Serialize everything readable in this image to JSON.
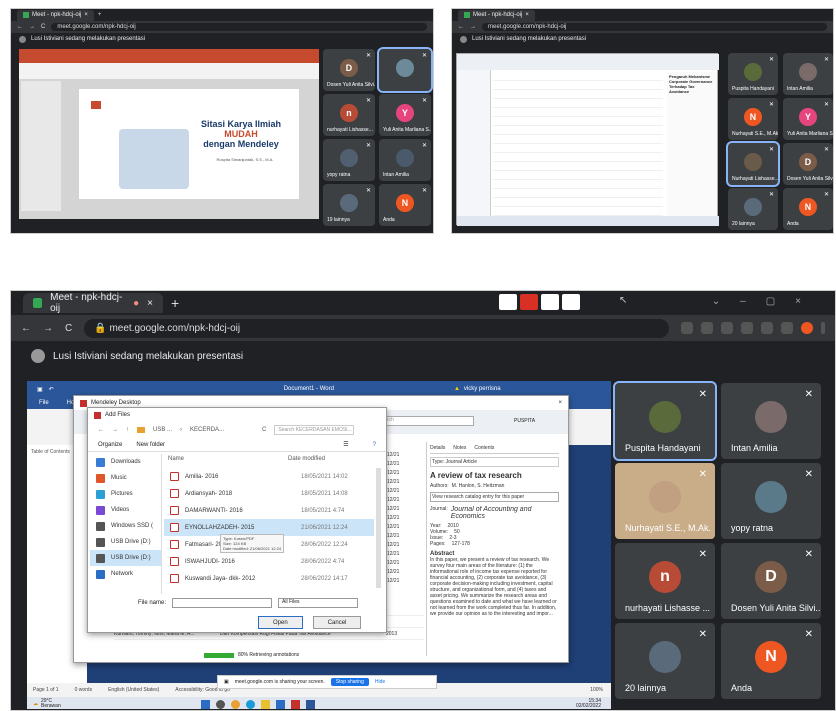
{
  "shot1": {
    "tab": "Meet - npk-hdcj-oij",
    "url": "meet.google.com/npk-hdcj-oij",
    "presenting": "Lusi Istiviani sedang melakukan presentasi",
    "slide": {
      "title1": "Sitasi Karya Ilmiah",
      "title2": "MUDAH",
      "title3": "dengan Mendeley",
      "author": "Rospita Simanjuntak, S.S., M.A."
    },
    "tiles": [
      {
        "initial": "D",
        "color": "#7b5c48",
        "name": "Dosen Yuli Anita Silvi..."
      },
      {
        "initial": "",
        "color": "#6d8a9a",
        "name": ""
      },
      {
        "initial": "n",
        "color": "#b84b36",
        "name": "nurhayati Lishasse..."
      },
      {
        "initial": "Y",
        "color": "#e6447c",
        "name": "Yuli Anita Marliana S..."
      },
      {
        "initial": "",
        "color": "#506070",
        "name": "yopy ratna"
      },
      {
        "initial": "",
        "color": "#4a5a6a",
        "name": "Intan Amilia"
      },
      {
        "initial": "",
        "color": "#5a6a7a",
        "name": "19 lainnya"
      },
      {
        "initial": "N",
        "color": "#ee5722",
        "name": "Anda"
      }
    ]
  },
  "shot2": {
    "tab": "Meet - npk-hdcj-oij",
    "url": "meet.google.com/npk-hdcj-oij",
    "presenting": "Lusi Istiviani sedang melakukan presentasi",
    "doc_title": "Pengaruh Mekanisme Corporate Governance Terhadap Tax Avoidance",
    "tiles": [
      {
        "initial": "",
        "color": "#5a6a3a",
        "name": "Puspita Handayani"
      },
      {
        "initial": "",
        "color": "#7a6a6a",
        "name": "Intan Amilia"
      },
      {
        "initial": "N",
        "color": "#ee5722",
        "name": "Nurhayati S.E., M.Ak."
      },
      {
        "initial": "Y",
        "color": "#e6447c",
        "name": "Yuli Anita Marliana S..."
      },
      {
        "initial": "",
        "color": "#6a5a4a",
        "name": "Nurhayati Lishasse..."
      },
      {
        "initial": "D",
        "color": "#7b5c48",
        "name": "Dosen Yuli Anita Silvi..."
      },
      {
        "initial": "",
        "color": "#5a6a7a",
        "name": "20 lainnya"
      },
      {
        "initial": "N",
        "color": "#ee5722",
        "name": "Anda"
      }
    ]
  },
  "shot3": {
    "tab": "Meet - npk-hdcj-oij",
    "url": "meet.google.com/npk-hdcj-oij",
    "presenting": "Lusi Istiviani sedang melakukan presentasi",
    "word": {
      "title": "Document1 - Word",
      "user": "vicky perrisna",
      "menu": [
        "File",
        "Home"
      ],
      "toc": "Table of Contents"
    },
    "mendeley": {
      "title": "Mendeley Desktop",
      "search_placeholder": "Search",
      "user": "PUSPITA",
      "dates": [
        "28/12/21",
        "28/12/21",
        "28/12/21",
        "28/12/21",
        "28/12/21",
        "28/12/21",
        "28/12/21",
        "28/12/21",
        "28/12/21",
        "28/12/21",
        "28/12/21",
        "28/12/21",
        "28/12/21",
        "28/12/21",
        "28/12/21"
      ],
      "tabs": [
        "Details",
        "Notes",
        "Contents"
      ],
      "type_label": "Type: Journal Article",
      "doc_title": "A review of tax research",
      "authors_label": "Authors:",
      "authors": "M. Hanlon, S. Heitzman",
      "view_catalog": "View research catalog entry for this paper",
      "journal_label": "Journal:",
      "journal": "Journal of Accounting and Economics",
      "year_label": "Year:",
      "year": "2010",
      "volume_label": "Volume:",
      "volume": "50",
      "issue_label": "Issue:",
      "issue": "2-3",
      "pages_label": "Pages:",
      "pages": "127-178",
      "abstract_label": "Abstract",
      "abstract": "In this paper, we present a review of tax research. We survey four main areas of the literature: (1) the informational role of income tax expense reported for financial accounting, (2) corporate tax avoidance, (3) corporate decision-making including investment, capital structure, and organizational form, and (4) taxes and asset pricing. We summarize the research areas and questions examined to date and what we have learned or not learned from the work completed thus far. In addition, we provide our opinion as to the interesting and impor...",
      "bottom_rows": [
        {
          "a": "Adhitara, Amali; Adjez, Charles K.",
          "b": "",
          "c": ""
        },
        {
          "a": "Dianty, Yunita Eka; M...",
          "b": "Pengaruh Pajak, Kepemilikan dan Kondisi Keuangan...",
          "c": ""
        },
        {
          "a": "Kurniarti, Tommy; Idris, Maria M; A...",
          "b": "Dan Kompensasi Rugi Fiskal Pada Tax Avoidance",
          "c": "2013"
        }
      ],
      "status": "80%  Retrieving annotations"
    },
    "dialog": {
      "title": "Add Files",
      "path": [
        "USB ...",
        "KECERDA..."
      ],
      "search_placeholder": "Search KECERDASAN EMOSI...",
      "organize": "Organize",
      "new_folder": "New folder",
      "col_name": "Name",
      "col_date": "Date modified",
      "nav": [
        "Downloads",
        "Music",
        "Pictures",
        "Videos",
        "Windows SSD (",
        "USB Drive (D:)",
        "USB Drive (D:)",
        "Network"
      ],
      "files": [
        {
          "name": "Amilia- 2016",
          "date": "18/05/2021 14:02"
        },
        {
          "name": "Ardiansyah- 2018",
          "date": "18/05/2021 14:08"
        },
        {
          "name": "DAMARWANTI- 2016",
          "date": "18/05/2021 4:74"
        },
        {
          "name": "EYNOLLAHZADEH- 2015",
          "date": "21/06/2021 12:24"
        },
        {
          "name": "Fatmasari- 2022",
          "date": "28/06/2022 12:24"
        },
        {
          "name": "ISWAHJUDI- 2016",
          "date": "28/06/2022 4:74"
        },
        {
          "name": "Kuswandi Jaya- dkk- 2012",
          "date": "28/06/2022 14:17"
        }
      ],
      "tooltip": [
        "Type: Kosen/PDF",
        "Size: 124 KB",
        "Date modified: 21/06/2021 12:24"
      ],
      "filename_label": "File name:",
      "filetype": "All Files",
      "open": "Open",
      "cancel": "Cancel"
    },
    "word_status": {
      "page": "Page 1 of 1",
      "words": "0 words",
      "lang": "English (United States)",
      "access": "Accessibility: Good to go",
      "zoom": "100%"
    },
    "share": {
      "msg": "meet.google.com is sharing your screen.",
      "stop": "Stop sharing",
      "hide": "Hide"
    },
    "taskbar": {
      "temp": "29°C",
      "weather": "Berawan",
      "time": "15:34",
      "date": "02/02/2022"
    },
    "tiles": [
      {
        "initial": "",
        "color": "#5a6a3a",
        "name": "Puspita Handayani"
      },
      {
        "initial": "",
        "color": "#7a6a6a",
        "name": "Intan Amilia"
      },
      {
        "initial": "",
        "color": "#c0a080",
        "name": "Nurhayati S.E., M.Ak."
      },
      {
        "initial": "",
        "color": "#5a7a8a",
        "name": "yopy ratna"
      },
      {
        "initial": "n",
        "color": "#b84b36",
        "name": "nurhayati Lishasse ..."
      },
      {
        "initial": "D",
        "color": "#7b5c48",
        "name": "Dosen Yuli Anita Silvi..."
      },
      {
        "initial": "",
        "color": "#5a6a7a",
        "name": "20 lainnya"
      },
      {
        "initial": "N",
        "color": "#ee5722",
        "name": "Anda"
      }
    ]
  }
}
